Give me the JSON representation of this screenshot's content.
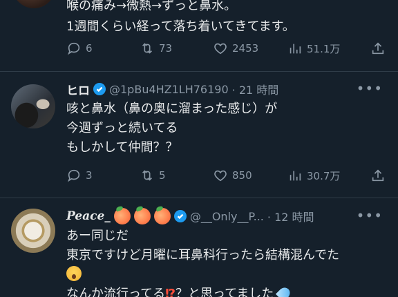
{
  "tweets": [
    {
      "text_line1": "喉の痛み→微熱→ずっと鼻水。",
      "text_line2": "1週間くらい経って落ち着いてきてます。",
      "stats": {
        "replies": "6",
        "retweets": "73",
        "likes": "2453",
        "views": "51.1万"
      }
    },
    {
      "name": "ヒロ",
      "handle": "@1pBu4HZ1LH76190",
      "time": "· 21 時間",
      "text_line1": "咳と鼻水（鼻の奥に溜まった感じ）が",
      "text_line2": "今週ずっと続いてる",
      "text_line3": "もしかして仲間？？",
      "stats": {
        "replies": "3",
        "retweets": "5",
        "likes": "850",
        "views": "30.7万"
      }
    },
    {
      "name": "Peace_",
      "handle": "@__Only__P...",
      "time": "· 12 時間",
      "text_line1": "あー同じだ",
      "text_line2": "東京ですけど月曜に耳鼻科行ったら結構混んでた",
      "text_line4_a": "なんか流行ってる",
      "text_line4_b": "？と思ってました"
    }
  ],
  "icons": {
    "reply": "reply-icon",
    "retweet": "retweet-icon",
    "like": "heart-icon",
    "views": "views-icon",
    "share": "share-icon",
    "more": "more-icon",
    "verified": "verified-badge-icon"
  },
  "colors": {
    "background": "#15202b",
    "text": "#e7e9ea",
    "muted": "#8b98a5",
    "verified": "#1d9bf0"
  }
}
